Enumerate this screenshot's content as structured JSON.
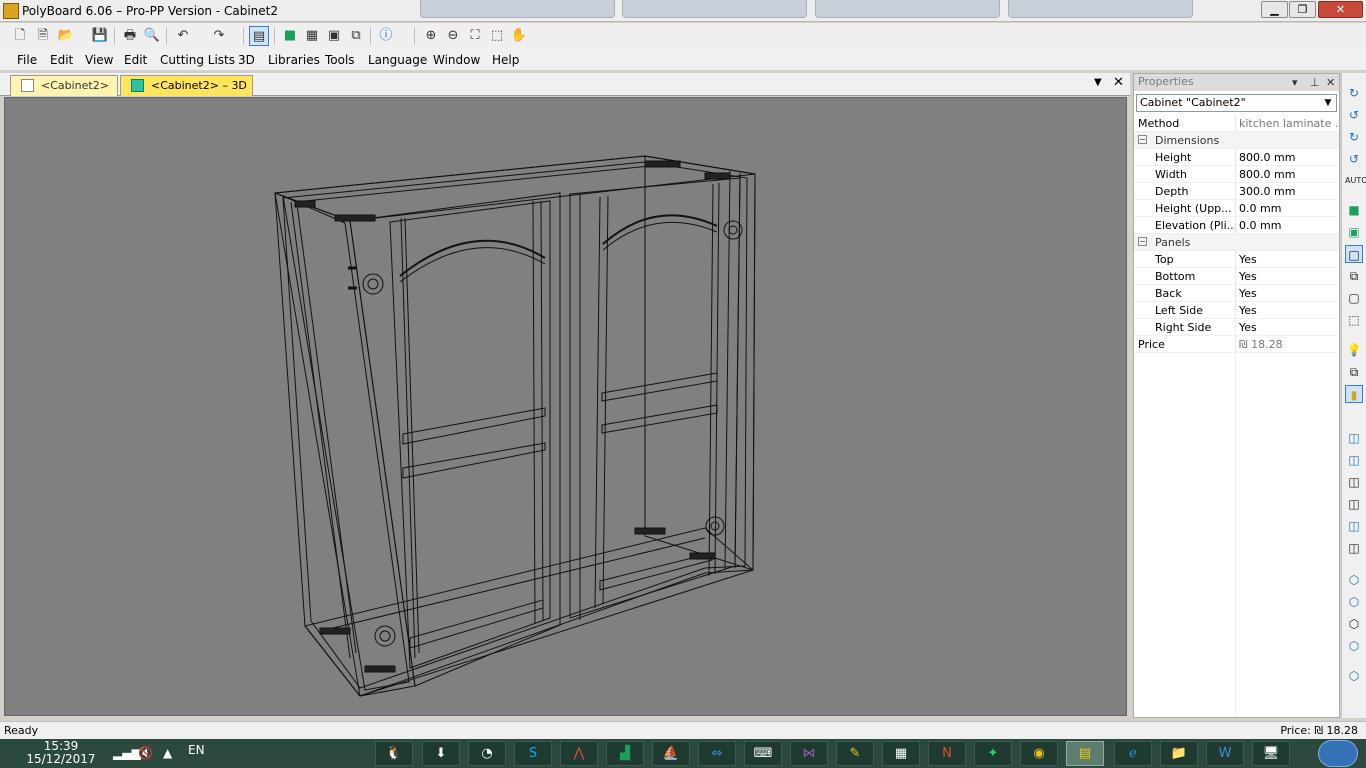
{
  "window": {
    "title": "PolyBoard 6.06 – Pro-PP Version - Cabinet2",
    "minimize": "▁",
    "maximize": "❐",
    "close": "✕"
  },
  "menu": [
    "File",
    "Edit",
    "View",
    "Edit",
    "Cutting Lists",
    "3D",
    "Libraries",
    "Tools",
    "Language",
    "Window",
    "Help"
  ],
  "doc_tabs": [
    {
      "label": "<Cabinet2>",
      "active": false
    },
    {
      "label": "<Cabinet2> – 3D",
      "active": true
    }
  ],
  "properties": {
    "header": "Properties",
    "selector": "Cabinet \"Cabinet2\"",
    "method": {
      "label": "Method",
      "value": "kitchen laminate ..."
    },
    "dimensions": {
      "label": "Dimensions",
      "items": [
        {
          "label": "Height",
          "value": "800.0 mm"
        },
        {
          "label": "Width",
          "value": "800.0 mm"
        },
        {
          "label": "Depth",
          "value": "300.0 mm"
        },
        {
          "label": "Height (Upp...",
          "value": "0.0 mm"
        },
        {
          "label": "Elevation (Pli...",
          "value": "0.0 mm"
        }
      ]
    },
    "panels": {
      "label": "Panels",
      "items": [
        {
          "label": "Top",
          "value": "Yes"
        },
        {
          "label": "Bottom",
          "value": "Yes"
        },
        {
          "label": "Back",
          "value": "Yes"
        },
        {
          "label": "Left Side",
          "value": "Yes"
        },
        {
          "label": "Right Side",
          "value": "Yes"
        }
      ]
    },
    "price": {
      "label": "Price",
      "value": "₪ 18.28"
    }
  },
  "status": {
    "left": "Ready",
    "right": "Price: ₪ 18.28"
  },
  "taskbar": {
    "time": "15:39",
    "date": "15/12/2017",
    "lang": "EN"
  },
  "icons": {
    "tb": [
      "new-icon",
      "new-icon",
      "open-icon",
      "save-icon",
      "print-icon",
      "print-preview-icon",
      "undo-icon",
      "redo-icon",
      "properties-icon",
      "cube-icon",
      "view-2d-icon",
      "view-3d-icon",
      "explode-icon",
      "info-icon",
      "zoom-in-icon",
      "zoom-out-icon",
      "zoom-extents-icon",
      "zoom-window-icon",
      "pan-hand-icon"
    ]
  },
  "colors": {
    "viewport": "#808080",
    "tab_active": "#ffe55c",
    "tab_inactive": "#fff3b0",
    "accent": "#1c6fb8"
  }
}
